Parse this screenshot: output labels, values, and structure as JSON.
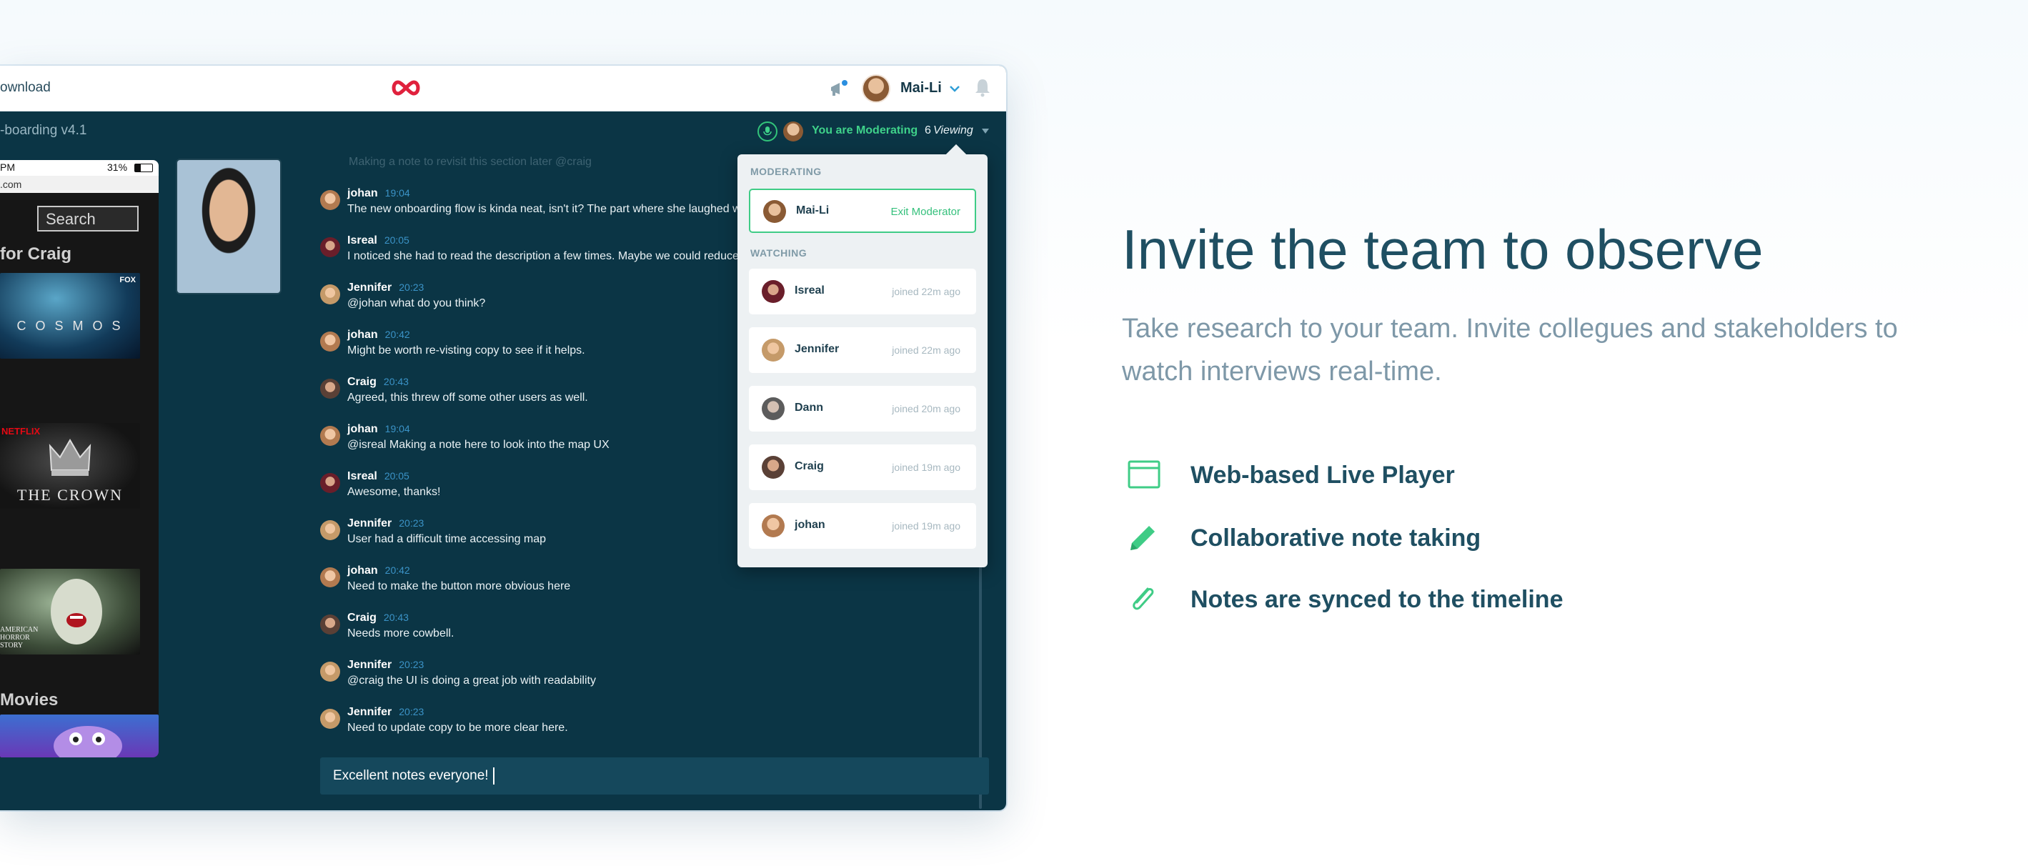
{
  "topbar": {
    "download_label": "ownload",
    "user_name": "Mai-Li"
  },
  "session": {
    "project_title": "-boarding v4.1",
    "moderating_text": "You are Moderating",
    "viewing_count": "6",
    "viewing_label": "Viewing"
  },
  "phone": {
    "status_time": "PM",
    "status_battery": "31%",
    "url": ".com",
    "search_label": "Search",
    "section_for_craig": "for Craig",
    "section_movies": "Movies",
    "tiles": {
      "cosmos": "C O S M O S",
      "crown": "THE CROWN",
      "ahs": "AMERICAN HORROR STORY",
      "fox_badge": "FOX",
      "netflix_badge": "NETFLIX"
    }
  },
  "notes": {
    "faded_note": "Making a note to revisit this section later @craig",
    "items": [
      {
        "author": "johan",
        "time": "19:04",
        "text": "The new onboarding flow is kinda neat, isn't it? The part where she laughed w"
      },
      {
        "author": "Isreal",
        "time": "20:05",
        "text": "I noticed she had to read the description a few times. Maybe we could reduce"
      },
      {
        "author": "Jennifer",
        "time": "20:23",
        "text": "@johan what do you think?"
      },
      {
        "author": "johan",
        "time": "20:42",
        "text": "Might be worth re-visting copy to see if it helps."
      },
      {
        "author": "Craig",
        "time": "20:43",
        "text": "Agreed, this threw off some other users as well."
      },
      {
        "author": "johan",
        "time": "19:04",
        "text": "@isreal Making a note here to look into the map UX"
      },
      {
        "author": "Isreal",
        "time": "20:05",
        "text": "Awesome, thanks!"
      },
      {
        "author": "Jennifer",
        "time": "20:23",
        "text": "User had a difficult time accessing map"
      },
      {
        "author": "johan",
        "time": "20:42",
        "text": "Need to make the button more obvious here"
      },
      {
        "author": "Craig",
        "time": "20:43",
        "text": "Needs more cowbell."
      },
      {
        "author": "Jennifer",
        "time": "20:23",
        "text": "@craig the UI is doing a great job with readability"
      },
      {
        "author": "Jennifer",
        "time": "20:23",
        "text": "Need to update copy to be more clear here."
      }
    ],
    "input_value": "Excellent notes everyone!"
  },
  "popover": {
    "moderating_heading": "MODERATING",
    "moderator_name": "Mai-Li",
    "exit_label": "Exit Moderator",
    "watching_heading": "WATCHING",
    "viewers": [
      {
        "name": "Isreal",
        "joined": "joined 22m ago"
      },
      {
        "name": "Jennifer",
        "joined": "joined 22m ago"
      },
      {
        "name": "Dann",
        "joined": "joined 20m ago"
      },
      {
        "name": "Craig",
        "joined": "joined 19m ago"
      },
      {
        "name": "johan",
        "joined": "joined 19m ago"
      }
    ]
  },
  "marketing": {
    "headline": "Invite the team to observe",
    "subcopy": "Take research to your team. Invite collegues and stakeholders to watch interviews real-time.",
    "features": [
      {
        "label": "Web-based Live Player",
        "icon": "browser-window-icon"
      },
      {
        "label": "Collaborative note taking",
        "icon": "pencil-icon"
      },
      {
        "label": "Notes are synced to the timeline",
        "icon": "paperclip-icon"
      }
    ]
  },
  "colors": {
    "app_bg": "#0b3545",
    "accent_green": "#3fd28a",
    "time_blue": "#3b93c7",
    "logo_red": "#e0213d",
    "headline": "#1f4f62",
    "subcopy": "#7e98a8"
  }
}
